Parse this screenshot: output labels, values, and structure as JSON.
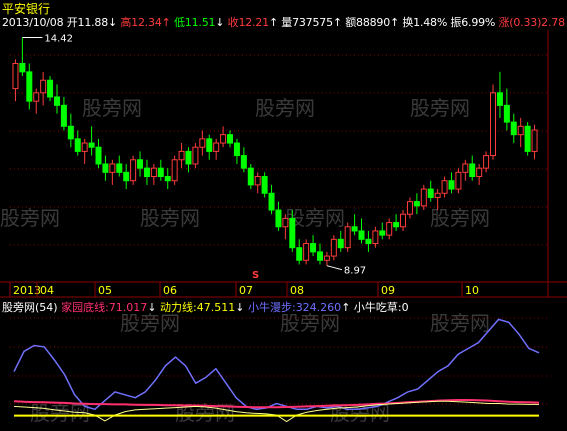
{
  "stock": {
    "title": "平安银行"
  },
  "quote": {
    "date": "2013/10/08",
    "open_label": "开",
    "open": "11.88",
    "open_arrow": "↓",
    "high_label": "高",
    "high": "12.34",
    "high_arrow": "↑",
    "low_label": "低",
    "low": "11.51",
    "low_arrow": "↓",
    "close_label": "收",
    "close": "12.21",
    "close_arrow": "↑",
    "volume_label": "量",
    "volume": "737575",
    "volume_arrow": "↑",
    "amount_label": "额",
    "amount": "88890",
    "amount_arrow": "↑",
    "turnover_label": "换",
    "turnover": "1.48%",
    "amplitude_label": "振",
    "amplitude": "6.99%",
    "change_label": "涨",
    "change": "(0.33)",
    "change_pct": "2.78"
  },
  "main_chart": {
    "max_label": "14.42",
    "min_label": "8.97",
    "signal_mark": "S",
    "month_labels": [
      "2013",
      "04",
      "05",
      "06",
      "07",
      "08",
      "09",
      "10"
    ]
  },
  "indicator": {
    "name": "股旁网",
    "param": "(54)",
    "line1_label": "家园底线:",
    "line1_value": "71.017",
    "line1_arrow": "↓",
    "line2_label": "动力线:",
    "line2_value": "47.511",
    "line2_arrow": "↓",
    "line3_label": "小牛漫步:",
    "line3_value": "324.260",
    "line3_arrow": "↑",
    "line4_label": "小牛吃草:",
    "line4_value": "0"
  },
  "watermark": "股旁网",
  "colors": {
    "up": "#ff3c3c",
    "down": "#00ff00",
    "grid": "#8b0000",
    "line_blue": "#7070ff",
    "line_red": "#ff3070",
    "line_yellow": "#ffff90"
  },
  "chart_data": {
    "type": "candlestick",
    "candles": [
      [
        13.2,
        13.9,
        12.9,
        13.8
      ],
      [
        13.8,
        14.42,
        13.5,
        13.6
      ],
      [
        13.6,
        13.8,
        12.7,
        12.9
      ],
      [
        12.9,
        13.2,
        12.6,
        13.1
      ],
      [
        13.1,
        13.6,
        12.8,
        13.4
      ],
      [
        13.4,
        13.5,
        12.9,
        13.0
      ],
      [
        13.0,
        13.3,
        12.6,
        12.8
      ],
      [
        12.8,
        13.0,
        12.2,
        12.3
      ],
      [
        12.3,
        12.6,
        11.8,
        12.0
      ],
      [
        12.0,
        12.2,
        11.6,
        11.7
      ],
      [
        11.7,
        12.0,
        11.4,
        11.9
      ],
      [
        11.9,
        12.3,
        11.6,
        11.8
      ],
      [
        11.8,
        12.0,
        11.3,
        11.4
      ],
      [
        11.4,
        11.6,
        11.0,
        11.2
      ],
      [
        11.2,
        11.5,
        10.9,
        11.4
      ],
      [
        11.4,
        11.6,
        11.1,
        11.2
      ],
      [
        11.2,
        11.4,
        10.8,
        11.0
      ],
      [
        11.0,
        11.6,
        10.9,
        11.5
      ],
      [
        11.5,
        11.7,
        11.1,
        11.3
      ],
      [
        11.3,
        11.5,
        10.9,
        11.1
      ],
      [
        11.1,
        11.4,
        10.9,
        11.3
      ],
      [
        11.3,
        11.5,
        11.0,
        11.1
      ],
      [
        11.1,
        11.3,
        10.8,
        11.0
      ],
      [
        11.0,
        11.6,
        10.9,
        11.5
      ],
      [
        11.5,
        11.9,
        11.3,
        11.7
      ],
      [
        11.7,
        11.8,
        11.2,
        11.4
      ],
      [
        11.4,
        11.9,
        11.3,
        11.8
      ],
      [
        11.8,
        12.2,
        11.6,
        12.0
      ],
      [
        12.0,
        12.1,
        11.5,
        11.7
      ],
      [
        11.7,
        12.0,
        11.5,
        11.9
      ],
      [
        11.9,
        12.3,
        11.8,
        12.1
      ],
      [
        12.1,
        12.2,
        11.8,
        11.9
      ],
      [
        11.9,
        12.0,
        11.4,
        11.6
      ],
      [
        11.6,
        11.8,
        11.2,
        11.3
      ],
      [
        11.3,
        11.4,
        10.8,
        10.9
      ],
      [
        10.9,
        11.2,
        10.7,
        11.1
      ],
      [
        11.1,
        11.2,
        10.6,
        10.7
      ],
      [
        10.7,
        10.9,
        10.2,
        10.3
      ],
      [
        10.3,
        10.5,
        9.8,
        9.9
      ],
      [
        9.9,
        10.2,
        9.6,
        10.1
      ],
      [
        10.1,
        10.3,
        9.3,
        9.4
      ],
      [
        9.4,
        9.6,
        9.0,
        9.1
      ],
      [
        9.1,
        9.6,
        9.0,
        9.5
      ],
      [
        9.5,
        9.7,
        9.2,
        9.3
      ],
      [
        9.3,
        9.5,
        9.0,
        9.1
      ],
      [
        9.1,
        9.3,
        8.97,
        9.2
      ],
      [
        9.2,
        9.7,
        9.1,
        9.6
      ],
      [
        9.6,
        9.8,
        9.3,
        9.4
      ],
      [
        9.4,
        10.0,
        9.3,
        9.9
      ],
      [
        9.9,
        10.2,
        9.7,
        9.8
      ],
      [
        9.8,
        10.1,
        9.5,
        9.6
      ],
      [
        9.6,
        9.8,
        9.3,
        9.5
      ],
      [
        9.5,
        9.9,
        9.4,
        9.8
      ],
      [
        9.8,
        10.0,
        9.6,
        9.7
      ],
      [
        9.7,
        10.1,
        9.6,
        10.0
      ],
      [
        10.0,
        10.2,
        9.8,
        9.9
      ],
      [
        9.9,
        10.3,
        9.8,
        10.2
      ],
      [
        10.2,
        10.6,
        10.1,
        10.5
      ],
      [
        10.5,
        10.7,
        10.2,
        10.4
      ],
      [
        10.4,
        10.9,
        10.3,
        10.8
      ],
      [
        10.8,
        11.0,
        10.5,
        10.6
      ],
      [
        10.6,
        10.8,
        10.3,
        10.7
      ],
      [
        10.7,
        11.1,
        10.6,
        11.0
      ],
      [
        11.0,
        11.2,
        10.7,
        10.8
      ],
      [
        10.8,
        11.3,
        10.7,
        11.2
      ],
      [
        11.2,
        11.5,
        11.0,
        11.4
      ],
      [
        11.4,
        11.6,
        11.0,
        11.1
      ],
      [
        11.1,
        11.4,
        10.9,
        11.3
      ],
      [
        11.3,
        11.7,
        11.2,
        11.6
      ],
      [
        11.6,
        13.3,
        11.5,
        13.1
      ],
      [
        13.1,
        13.6,
        12.5,
        12.8
      ],
      [
        12.8,
        13.2,
        12.2,
        12.4
      ],
      [
        12.4,
        12.6,
        11.9,
        12.1
      ],
      [
        12.1,
        12.5,
        11.8,
        12.3
      ],
      [
        12.3,
        12.4,
        11.6,
        11.7
      ],
      [
        11.7,
        12.34,
        11.51,
        12.21
      ]
    ]
  }
}
